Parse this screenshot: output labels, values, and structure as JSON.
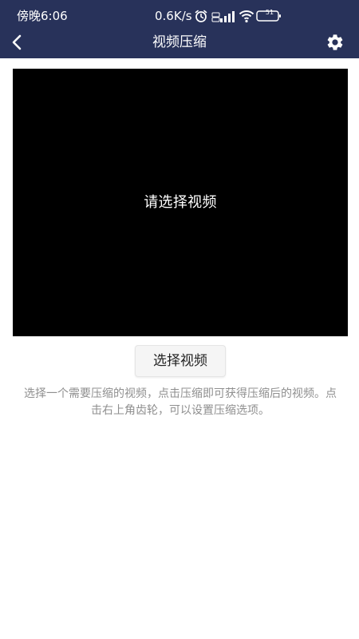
{
  "status_bar": {
    "time": "傍晚6:06",
    "network_speed": "0.6K/s",
    "battery_level": "51"
  },
  "header": {
    "title": "视频压缩"
  },
  "preview": {
    "placeholder": "请选择视频"
  },
  "actions": {
    "select_video_label": "选择视频"
  },
  "instructions": {
    "text": "选择一个需要压缩的视频，点击压缩即可获得压缩后的视频。点击右上角齿轮，可以设置压缩选项。"
  },
  "colors": {
    "header_bg": "#28325a",
    "preview_bg": "#000000",
    "page_bg": "#ffffff",
    "button_bg": "#f5f5f5",
    "instructions_text": "#8f8f8f"
  },
  "icons": {
    "back": "chevron-left-icon",
    "settings": "gear-icon",
    "alarm": "alarm-icon",
    "signal": "signal-icon",
    "wifi": "wifi-icon",
    "battery": "battery-icon"
  }
}
